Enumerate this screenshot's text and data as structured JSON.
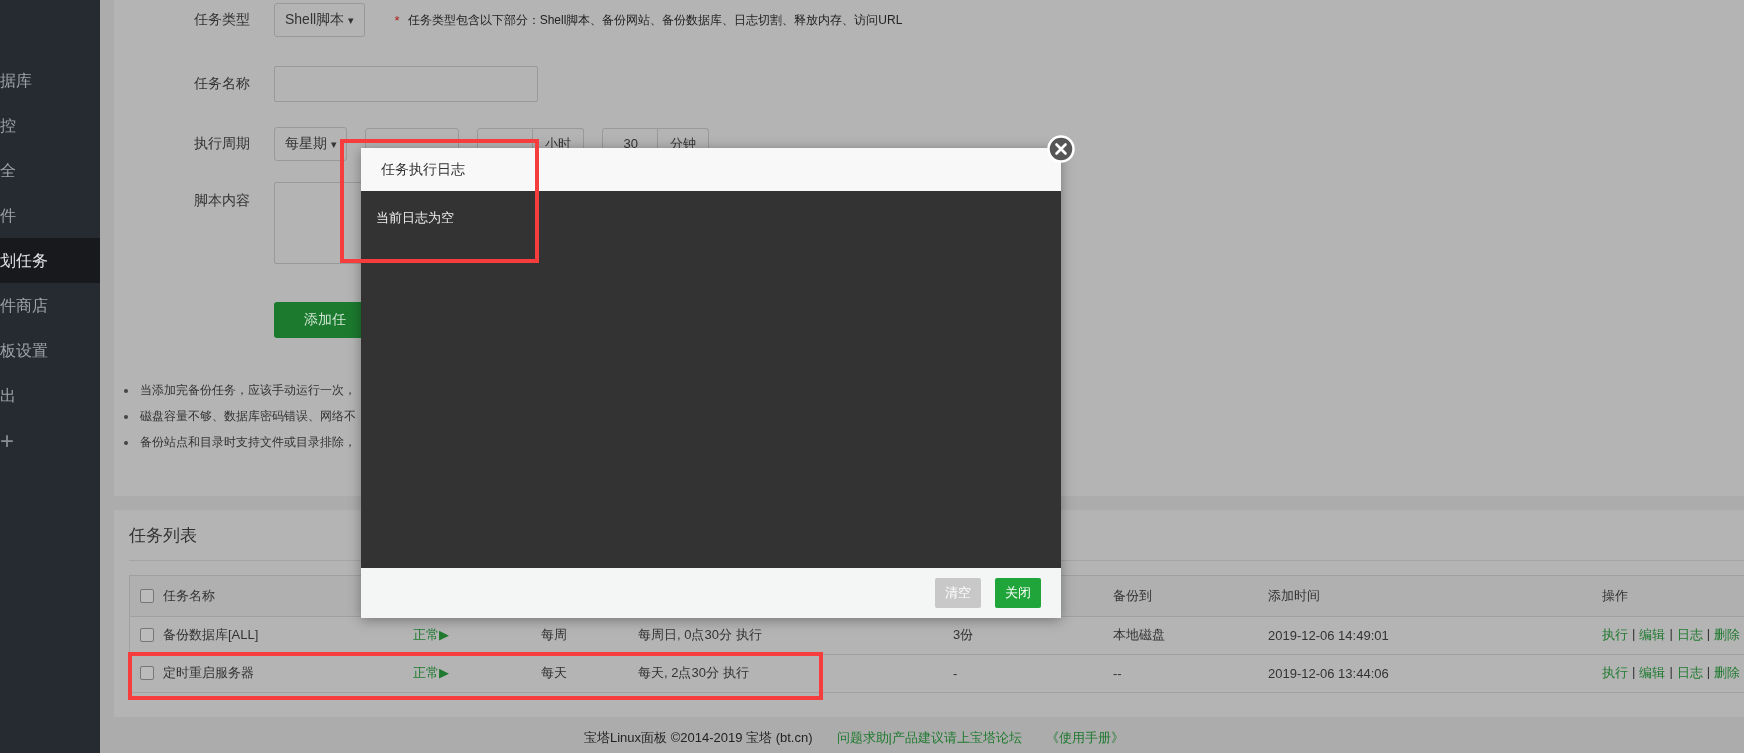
{
  "sidebar": {
    "items": [
      {
        "label": "据库",
        "selected": false
      },
      {
        "label": "控",
        "selected": false
      },
      {
        "label": "全",
        "selected": false
      },
      {
        "label": "件",
        "selected": false
      },
      {
        "label": "划任务",
        "selected": true
      },
      {
        "label": "件商店",
        "selected": false
      },
      {
        "label": "板设置",
        "selected": false
      },
      {
        "label": "出",
        "selected": false
      }
    ],
    "add": "+"
  },
  "form": {
    "task_type": {
      "label": "任务类型",
      "value": "Shell脚本",
      "caret": "▾",
      "required_mark": "*",
      "note": "任务类型包含以下部分：Shell脚本、备份网站、备份数据库、日志切割、释放内存、访问URL"
    },
    "task_name": {
      "label": "任务名称"
    },
    "period": {
      "label": "执行周期",
      "cycle": "每星期",
      "caret": "▾",
      "hour_unit": "小时",
      "minute": "30",
      "minute_unit": "分钟"
    },
    "script": {
      "label": "脚本内容"
    },
    "submit": "添加任"
  },
  "tips": [
    "当添加完备份任务，应该手动运行一次，",
    "磁盘容量不够、数据库密码错误、网络不",
    "备份站点和目录时支持文件或目录排除，"
  ],
  "task_list": {
    "title": "任务列表",
    "all_checked": false,
    "action_separator": "|",
    "columns": [
      {
        "label": "任务名称"
      },
      {
        "label": "备份到"
      },
      {
        "label": "添加时间"
      },
      {
        "label": "操作"
      }
    ],
    "rows": [
      {
        "checked": false,
        "name": "备份数据库[ALL]",
        "status": "正常▶",
        "period": "每周",
        "schedule": "每周日, 0点30分 执行",
        "keep": "3份",
        "backup_to": "本地磁盘",
        "added": "2019-12-06 14:49:01",
        "actions": [
          "执行",
          "编辑",
          "日志",
          "删除"
        ]
      },
      {
        "checked": false,
        "name": "定时重启服务器",
        "status": "正常▶",
        "period": "每天",
        "schedule": "每天, 2点30分 执行",
        "keep": "-",
        "backup_to": "--",
        "added": "2019-12-06 13:44:06",
        "actions": [
          "执行",
          "编辑",
          "日志",
          "删除"
        ]
      }
    ]
  },
  "footer": {
    "copyright": "宝塔Linux面板 ©2014-2019 宝塔 (bt.cn)",
    "links": [
      "问题求助|产品建议请上宝塔论坛",
      "《使用手册》"
    ]
  },
  "modal": {
    "title": "任务执行日志",
    "log": "当前日志为空",
    "buttons": [
      {
        "label": "清空",
        "kind": "secondary"
      },
      {
        "label": "关闭",
        "kind": "primary"
      }
    ]
  }
}
